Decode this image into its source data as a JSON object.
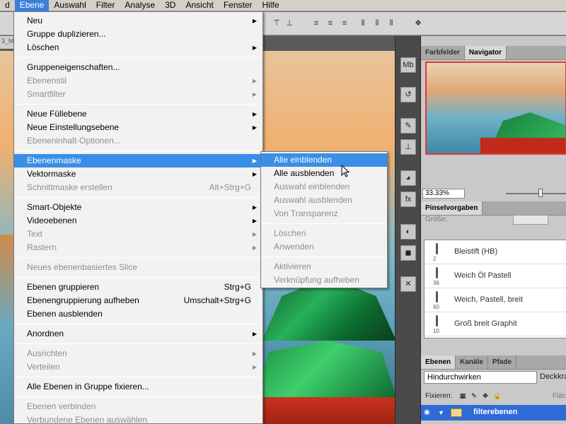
{
  "menubar": {
    "items": [
      "d",
      "Ebene",
      "Auswahl",
      "Filter",
      "Analyse",
      "3D",
      "Ansicht",
      "Fenster",
      "Hilfe"
    ],
    "active_index": 1
  },
  "document": {
    "tab_label": "3_M"
  },
  "menu": {
    "items": [
      {
        "label": "Neu",
        "submenu": true
      },
      {
        "label": "Gruppe duplizieren..."
      },
      {
        "label": "Löschen",
        "submenu": true
      },
      {
        "sep": true
      },
      {
        "label": "Gruppeneigenschaften..."
      },
      {
        "label": "Ebenenstil",
        "submenu": true,
        "disabled": true
      },
      {
        "label": "Smartfilter",
        "submenu": true,
        "disabled": true
      },
      {
        "sep": true
      },
      {
        "label": "Neue Füllebene",
        "submenu": true
      },
      {
        "label": "Neue Einstellungsebene",
        "submenu": true
      },
      {
        "label": "Ebeneninhalt-Optionen...",
        "disabled": true
      },
      {
        "sep": true
      },
      {
        "label": "Ebenenmaske",
        "submenu": true,
        "highlight": true
      },
      {
        "label": "Vektormaske",
        "submenu": true
      },
      {
        "label": "Schnittmaske erstellen",
        "shortcut": "Alt+Strg+G",
        "disabled": true
      },
      {
        "sep": true
      },
      {
        "label": "Smart-Objekte",
        "submenu": true
      },
      {
        "label": "Videoebenen",
        "submenu": true
      },
      {
        "label": "Text",
        "submenu": true,
        "disabled": true
      },
      {
        "label": "Rastern",
        "submenu": true,
        "disabled": true
      },
      {
        "sep": true
      },
      {
        "label": "Neues ebenenbasiertes Slice",
        "disabled": true
      },
      {
        "sep": true
      },
      {
        "label": "Ebenen gruppieren",
        "shortcut": "Strg+G"
      },
      {
        "label": "Ebenengruppierung aufheben",
        "shortcut": "Umschalt+Strg+G"
      },
      {
        "label": "Ebenen ausblenden"
      },
      {
        "sep": true
      },
      {
        "label": "Anordnen",
        "submenu": true
      },
      {
        "sep": true
      },
      {
        "label": "Ausrichten",
        "submenu": true,
        "disabled": true
      },
      {
        "label": "Verteilen",
        "submenu": true,
        "disabled": true
      },
      {
        "sep": true
      },
      {
        "label": "Alle Ebenen in Gruppe fixieren..."
      },
      {
        "sep": true
      },
      {
        "label": "Ebenen verbinden",
        "disabled": true
      },
      {
        "label": "Verbundene Ebenen auswählen",
        "disabled": true
      }
    ]
  },
  "submenu": {
    "items": [
      {
        "label": "Alle einblenden",
        "highlight": true
      },
      {
        "label": "Alle ausblenden"
      },
      {
        "label": "Auswahl einblenden",
        "disabled": true
      },
      {
        "label": "Auswahl ausblenden",
        "disabled": true
      },
      {
        "label": "Von Transparenz",
        "disabled": true
      },
      {
        "sep": true
      },
      {
        "label": "Löschen",
        "disabled": true
      },
      {
        "label": "Anwenden",
        "disabled": true
      },
      {
        "sep": true
      },
      {
        "label": "Aktivieren",
        "disabled": true
      },
      {
        "label": "Verknüpfung aufheben",
        "disabled": true
      }
    ]
  },
  "panels": {
    "navigator_tabs": [
      "Farbfelder",
      "Navigator"
    ],
    "navigator_active": 1,
    "zoom": "33.33%",
    "brush_tabs": [
      "Pinselvorgaben"
    ],
    "brush_size_label": "Größe:",
    "brushes": [
      {
        "num": "2",
        "name": "Bleistift (HB)"
      },
      {
        "num": "36",
        "name": "Weich Öl Pastell"
      },
      {
        "num": "60",
        "name": "Weich, Pastell, breit"
      },
      {
        "num": "10",
        "name": "Groß breit Graphit"
      }
    ],
    "layer_tabs": [
      "Ebenen",
      "Kanäle",
      "Pfade"
    ],
    "layer_active": 0,
    "blend_mode": "Hindurchwirken",
    "opacity_label": "Deckkra",
    "lock_label": "Fixieren:",
    "fill_label": "Fläch",
    "layer_name": "filterebenen"
  },
  "icons": {
    "dock": [
      "mini-bridge-icon",
      "history-icon",
      "brush-icon",
      "stamp-icon",
      "swatches-icon",
      "fx-icon",
      "mask-icon",
      "adjust-icon",
      "tools-icon"
    ]
  }
}
